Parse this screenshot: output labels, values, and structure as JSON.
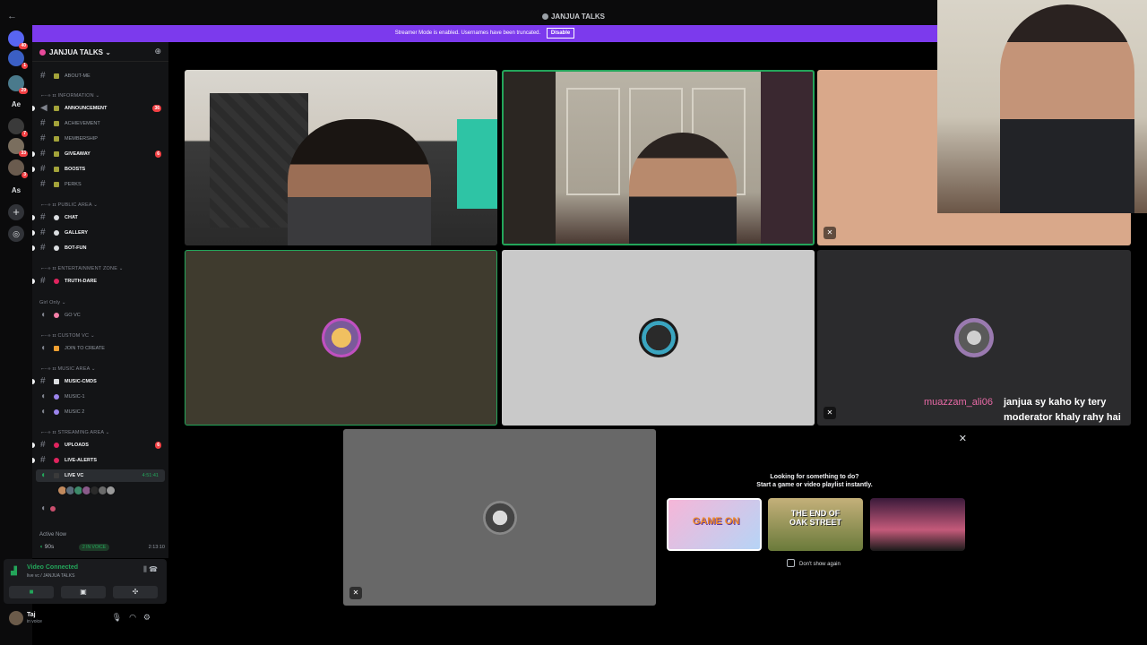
{
  "window": {
    "title": "JANJUA TALKS"
  },
  "banner": {
    "text": "Streamer Mode is enabled. Usernames have been truncated.",
    "button": "Disable"
  },
  "guild": {
    "name": "JANJUA TALKS"
  },
  "rail": {
    "servers": [
      {
        "badge": "40"
      },
      {
        "badge": "1"
      },
      {
        "badge": "29"
      },
      {
        "text": "Ae"
      },
      {
        "badge": "7"
      },
      {
        "badge": "33"
      },
      {
        "badge": "3"
      },
      {
        "text": "As"
      }
    ]
  },
  "channels": {
    "about": "ABOUT-ME",
    "cat_information": "INFORMATION",
    "announcement": "ANNOUNCEMENT",
    "announcement_badge": "36",
    "achievement": "ACHIEVEMENT",
    "membership": "MEMBERSHIP",
    "giveaway": "GIVEAWAY",
    "giveaway_badge": "6",
    "boosts": "BOOSTS",
    "perks": "PERKS",
    "cat_public": "PUBLIC AREA",
    "chat": "CHAT",
    "gallery": "GALLERY",
    "botfun": "BOT-FUN",
    "cat_entertainment": "ENTERTAINMENT ZONE",
    "truthdare": "TRUTH-DARE",
    "cat_girl": "Girl Only",
    "govc": "GO VC",
    "cat_custom": "CUSTOM VC",
    "jointocreate": "JOIN TO CREATE",
    "cat_music": "MUSIC AREA",
    "musiccmds": "MUSIC-CMDS",
    "music1": "MUSIC-1",
    "music2": "MUSIC 2",
    "cat_streaming": "STREAMING AREA",
    "uploads": "UPLOADS",
    "uploads_badge": "6",
    "livealerts": "LIVE-ALERTS",
    "livevc": "LIVE VC",
    "livevc_time": "4:51:41"
  },
  "active_now": {
    "heading": "Active Now",
    "name": "90s",
    "badge": "2 IN VOICE",
    "time": "2:13:10"
  },
  "voice_panel": {
    "status": "Video Connected",
    "location": "live vc / JANJUA TALKS"
  },
  "user_panel": {
    "name": "Taj",
    "status": "in voice"
  },
  "chat": {
    "user": "muazzam_ali06",
    "message": "janjua sy kaho ky tery moderator khaly rahy hai"
  },
  "activity": {
    "line1": "Looking for something to do?",
    "line2": "Start a game or video playlist instantly.",
    "cards": [
      "GAME ON",
      "THE END OF OAK STREET",
      ""
    ],
    "dont_show": "Don't show again"
  },
  "colors": {
    "accent": "#7c3aed",
    "speaking": "#23a55a",
    "tile_olive": "#3f3b2e",
    "tile_silver": "#c9c9c9",
    "tile_dark": "#2b2b2d",
    "tile_grey": "#686868",
    "tile_peach": "#d9a88a"
  }
}
